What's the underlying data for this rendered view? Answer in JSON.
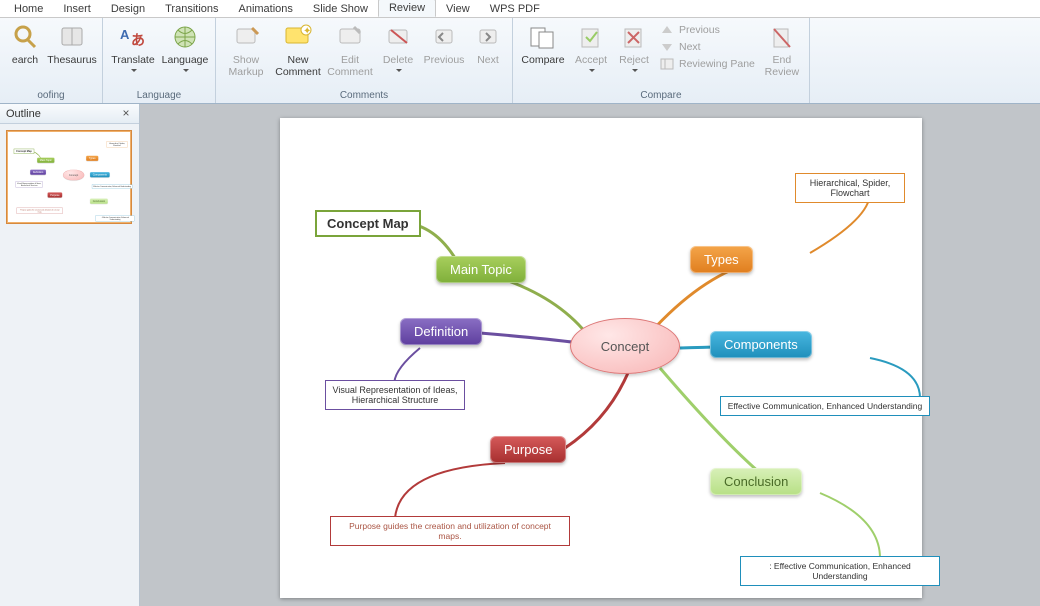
{
  "tabs": {
    "home": "Home",
    "insert": "Insert",
    "design": "Design",
    "transitions": "Transitions",
    "animations": "Animations",
    "slideshow": "Slide Show",
    "review": "Review",
    "view": "View",
    "wpspdf": "WPS PDF"
  },
  "ribbon": {
    "proofing": {
      "label": "oofing",
      "search": "earch",
      "thesaurus": "Thesaurus"
    },
    "language": {
      "label": "Language",
      "translate": "Translate",
      "language": "Language"
    },
    "comments": {
      "label": "Comments",
      "show_markup": "Show Markup",
      "new_comment": "New Comment",
      "edit_comment": "Edit Comment",
      "delete": "Delete",
      "previous": "Previous",
      "next": "Next"
    },
    "compare": {
      "label": "Compare",
      "compare": "Compare",
      "accept": "Accept",
      "reject": "Reject",
      "prev": "Previous",
      "next": "Next",
      "reviewing_pane": "Reviewing Pane",
      "end_review": "End Review"
    }
  },
  "sidepanel": {
    "outline": "Outline"
  },
  "map": {
    "title": "Concept Map",
    "center": "Concept",
    "main_topic": "Main Topic",
    "definition": "Definition",
    "purpose": "Purpose",
    "types": "Types",
    "components": "Components",
    "conclusion": "Conclusion",
    "def_note": "Visual Representation of Ideas, Hierarchical Structure",
    "purpose_note": "Purpose guides the creation and utilization of concept maps.",
    "types_note": "Hierarchical, Spider, Flowchart",
    "components_note": "Effective Communication, Enhanced Understanding",
    "conclusion_note": ": Effective Communication, Enhanced Understanding"
  }
}
